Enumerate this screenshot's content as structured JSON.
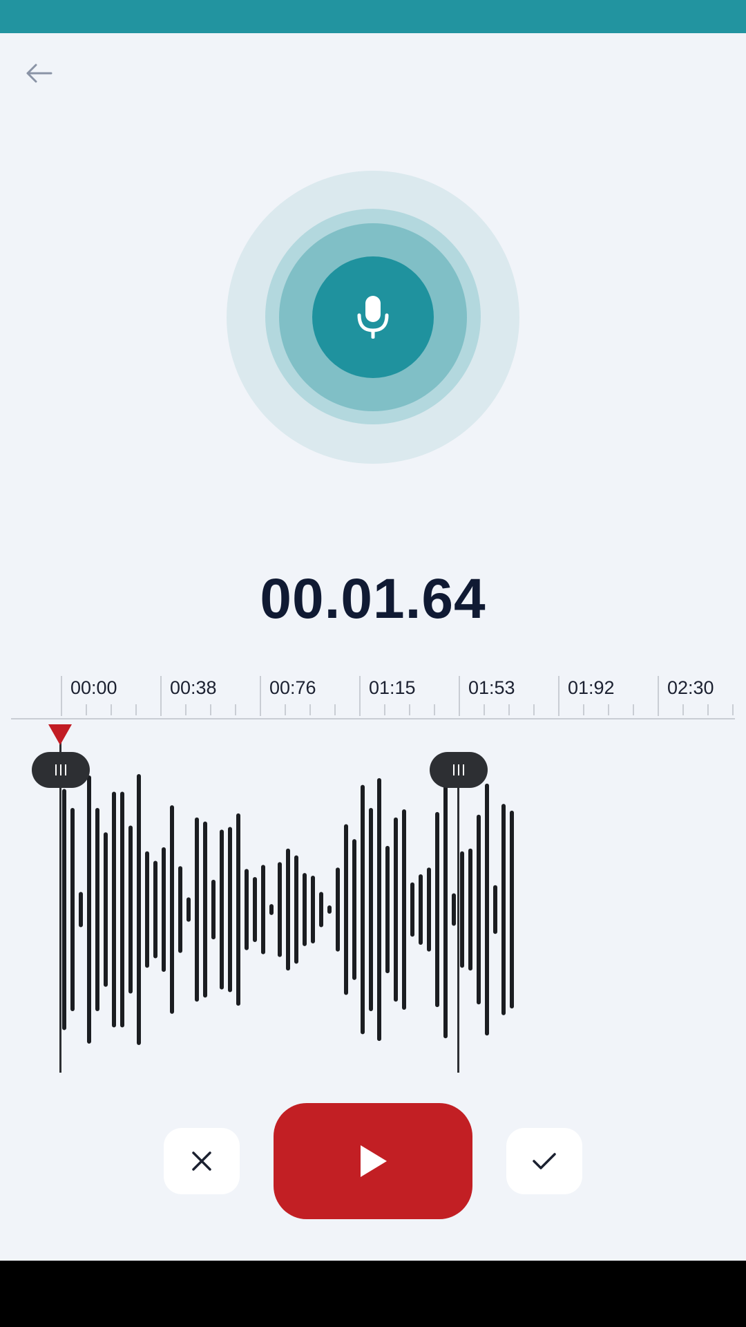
{
  "colors": {
    "status_bar": "#2294a0",
    "accent_teal": "#1f929e",
    "play_red": "#c21f24",
    "playhead_red": "#c21c24",
    "waveform_bars": "#1b1d21",
    "background": "#f1f4f9"
  },
  "icons": {
    "back": "back-arrow-icon",
    "mic": "microphone-icon",
    "cancel": "close-icon",
    "confirm": "checkmark-icon",
    "play": "play-icon",
    "grip": "grip-icon"
  },
  "recording": {
    "timer": "00.01.64",
    "state": "recording"
  },
  "timeline": {
    "labels": [
      "00:00",
      "00:38",
      "00:76",
      "01:15",
      "01:53",
      "01:92",
      "02:30"
    ]
  },
  "waveform": {
    "amplitudes": [
      0.89,
      0.75,
      0.13,
      0.99,
      0.75,
      0.57,
      0.87,
      0.87,
      0.62,
      1.0,
      0.43,
      0.36,
      0.46,
      0.77,
      0.32,
      0.09,
      0.68,
      0.65,
      0.22,
      0.59,
      0.61,
      0.71,
      0.3,
      0.24,
      0.33,
      0.04,
      0.35,
      0.45,
      0.4,
      0.27,
      0.25,
      0.13,
      0.03,
      0.31,
      0.63,
      0.52,
      0.92,
      0.75,
      0.97,
      0.47,
      0.68,
      0.74,
      0.2,
      0.26,
      0.31,
      0.72,
      0.95,
      0.12,
      0.43,
      0.45,
      0.7,
      0.93,
      0.18,
      0.78,
      0.73
    ],
    "selection_start": 0.0,
    "selection_end": 1.0
  },
  "controls": {
    "cancel": "close-icon",
    "play": "play-icon",
    "confirm": "checkmark-icon"
  }
}
